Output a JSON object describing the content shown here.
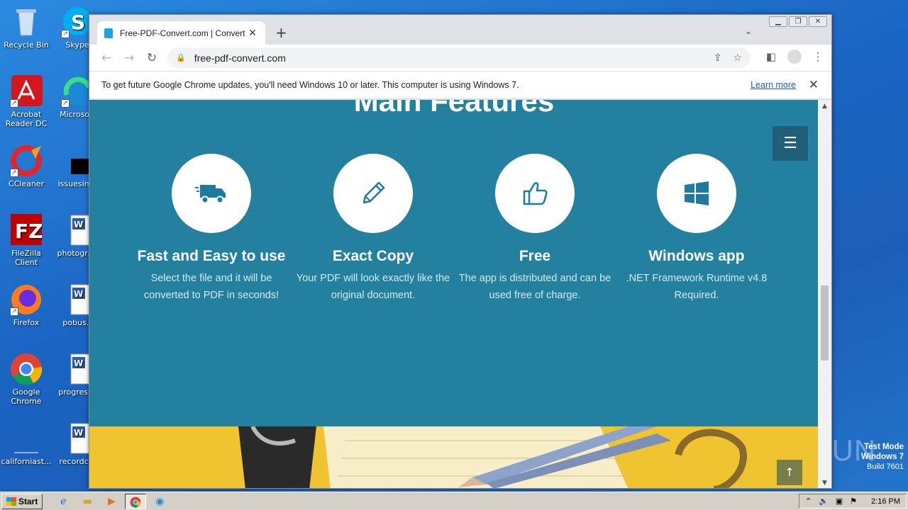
{
  "desktop": {
    "icons": [
      {
        "label": "Recycle Bin",
        "icon": "recycle-bin-icon"
      },
      {
        "label": "Acrobat Reader DC",
        "icon": "acrobat-icon"
      },
      {
        "label": "CCleaner",
        "icon": "ccleaner-icon"
      },
      {
        "label": "FileZilla Client",
        "icon": "filezilla-icon"
      },
      {
        "label": "Firefox",
        "icon": "firefox-icon"
      },
      {
        "label": "Google Chrome",
        "icon": "chrome-icon"
      },
      {
        "label": "californiast...",
        "icon": "file-icon"
      },
      {
        "label": "Skype",
        "icon": "skype-icon"
      },
      {
        "label": "Microsoft",
        "icon": "edge-icon"
      },
      {
        "label": "issuesimp",
        "icon": "file-icon"
      },
      {
        "label": "photograp",
        "icon": "word-doc-icon"
      },
      {
        "label": "pobus.r",
        "icon": "word-doc-icon"
      },
      {
        "label": "progressc",
        "icon": "word-doc-icon"
      },
      {
        "label": "recordclo",
        "icon": "word-doc-icon"
      }
    ]
  },
  "browser": {
    "tab_title": "Free-PDF-Convert.com | Convert hu",
    "url": "free-pdf-convert.com",
    "infobar_text": "To get future Google Chrome updates, you'll need Windows 10 or later. This computer is using Windows 7.",
    "infobar_link": "Learn more"
  },
  "page": {
    "section_heading": "Main Features",
    "features": [
      {
        "icon": "truck-icon",
        "title": "Fast and Easy to use",
        "text": "Select the file and it will be converted to PDF in seconds!"
      },
      {
        "icon": "pencil-icon",
        "title": "Exact Copy",
        "text": "Your PDF will look exactly like the original document."
      },
      {
        "icon": "thumbs-up-icon",
        "title": "Free",
        "text": "The app is distributed and can be used free of charge."
      },
      {
        "icon": "windows-icon",
        "title": "Windows app",
        "text": ".NET Framework Runtime v4.8 Required."
      }
    ]
  },
  "taskbar": {
    "start_label": "Start",
    "clock": "2:16 PM"
  },
  "watermark": {
    "line1": "Test Mode",
    "line2": "Windows 7",
    "line3": "Build 7601",
    "brand": "ANY RUN"
  },
  "colors": {
    "page_bg": "#23819f",
    "accent": "#1f5f78",
    "banner": "#f0c330"
  }
}
